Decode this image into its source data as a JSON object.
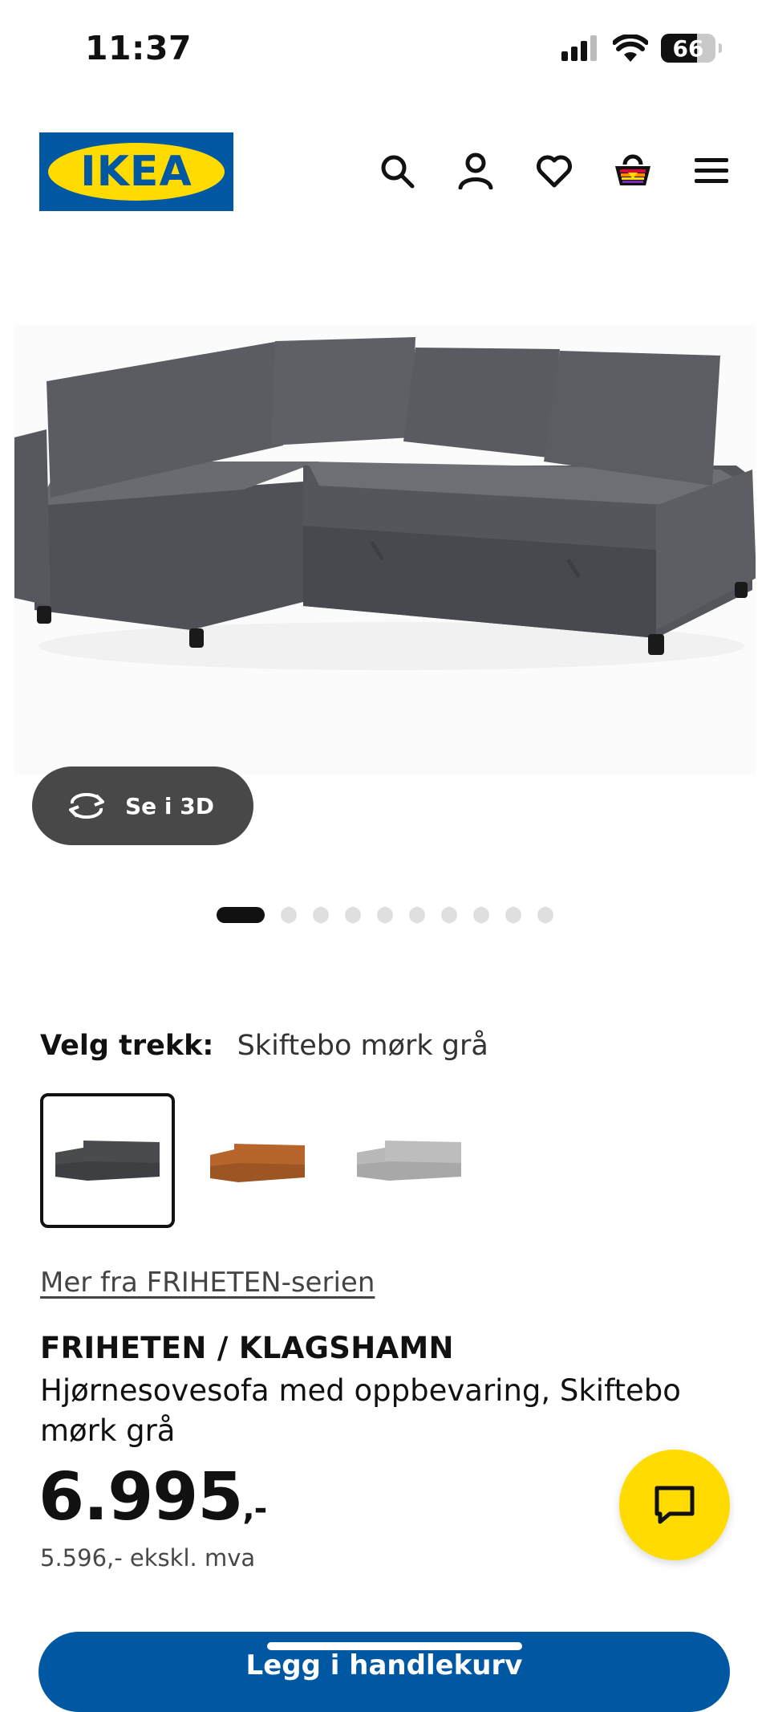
{
  "status_bar": {
    "time": "11:37",
    "battery_percent": "66"
  },
  "header": {
    "logo_text": "IKEA",
    "icons": [
      "search-icon",
      "user-icon",
      "heart-icon",
      "basket-icon",
      "menu-icon"
    ]
  },
  "gallery": {
    "view_3d_label": "Se i 3D",
    "slide_count": 10,
    "active_slide": 1
  },
  "variant": {
    "label": "Velg trekk:",
    "selected_value": "Skiftebo mørk grå",
    "swatches": [
      {
        "color": "#4a4b4f",
        "selected": true
      },
      {
        "color": "#b7652c",
        "selected": false
      },
      {
        "color": "#b9b9b9",
        "selected": false
      }
    ]
  },
  "series_link": "Mer fra FRIHETEN-serien",
  "product": {
    "name": "FRIHETEN / KLAGSHAMN",
    "description": "Hjørnesovesofa med oppbevaring, Skiftebo mørk grå",
    "price": "6.995",
    "price_suffix": ",-",
    "price_ex_vat": "5.596,- ekskl. mva"
  },
  "cta": {
    "label": "Legg i handlekurv"
  },
  "colors": {
    "ikea_blue": "#0058a3",
    "ikea_yellow": "#ffdb00",
    "sofa_gray": "#4a4b4f"
  }
}
